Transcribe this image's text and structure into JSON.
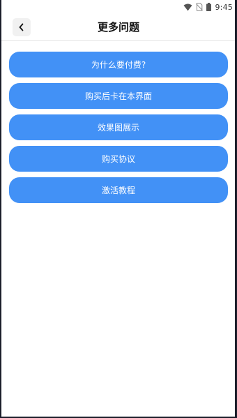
{
  "status_bar": {
    "time": "9:45",
    "icons": [
      "wifi-icon",
      "no-sim-icon",
      "battery-icon"
    ]
  },
  "header": {
    "title": "更多问题",
    "back_icon": "chevron-left-icon"
  },
  "faq": {
    "items": [
      {
        "label": "为什么要付费?"
      },
      {
        "label": "购买后卡在本界面"
      },
      {
        "label": "效果图展示"
      },
      {
        "label": "购买协议"
      },
      {
        "label": "激活教程"
      }
    ]
  },
  "colors": {
    "accent": "#4291f6",
    "background": "#ffffff",
    "frame": "#1c1f2b"
  }
}
